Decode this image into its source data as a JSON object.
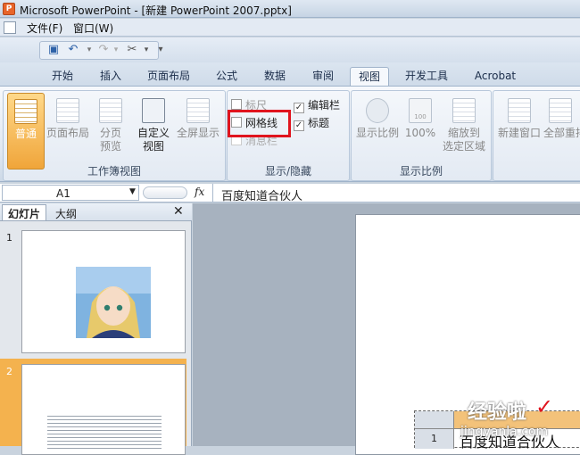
{
  "window": {
    "title": "Microsoft PowerPoint - [新建 PowerPoint 2007.pptx]",
    "app_icon": "powerpoint-icon"
  },
  "menu": {
    "file": "文件(F)",
    "window": "窗口(W)"
  },
  "tabs": [
    "开始",
    "插入",
    "页面布局",
    "公式",
    "数据",
    "审阅",
    "视图",
    "开发工具",
    "Acrobat"
  ],
  "active_tab": "视图",
  "ribbon": {
    "workbook_views": {
      "label": "工作簿视图",
      "normal": "普通",
      "page_layout": "页面布局",
      "page_break_1": "分页",
      "page_break_2": "预览",
      "custom_1": "自定义",
      "custom_2": "视图",
      "fullscreen": "全屏显示"
    },
    "show_hide": {
      "label": "显示/隐藏",
      "ruler": "标尺",
      "gridlines": "网格线",
      "message_bar": "消息栏",
      "formula_bar": "编辑栏",
      "headings": "标题"
    },
    "zoom": {
      "label": "显示比例",
      "zoom": "显示比例",
      "hundred": "100%",
      "to_sel_1": "缩放到",
      "to_sel_2": "选定区域",
      "hundred_icon_text": "100"
    },
    "window": {
      "new_window": "新建窗口",
      "arrange_all": "全部重排"
    }
  },
  "formula_bar": {
    "name_box": "A1",
    "fx": "fx",
    "content": "百度知道合伙人"
  },
  "panel": {
    "tab_slides": "幻灯片",
    "tab_outline": "大纲",
    "close": "✕"
  },
  "slides": [
    {
      "number": "1"
    },
    {
      "number": "2"
    }
  ],
  "workspace": {
    "table_row_number": "1",
    "table_cell_text": "百度知道合伙人"
  },
  "watermark": {
    "text": "经验啦",
    "url": "jingyanla.com"
  },
  "colors": {
    "highlight_box": "#e0141e",
    "active_view": "#f0a53a"
  }
}
